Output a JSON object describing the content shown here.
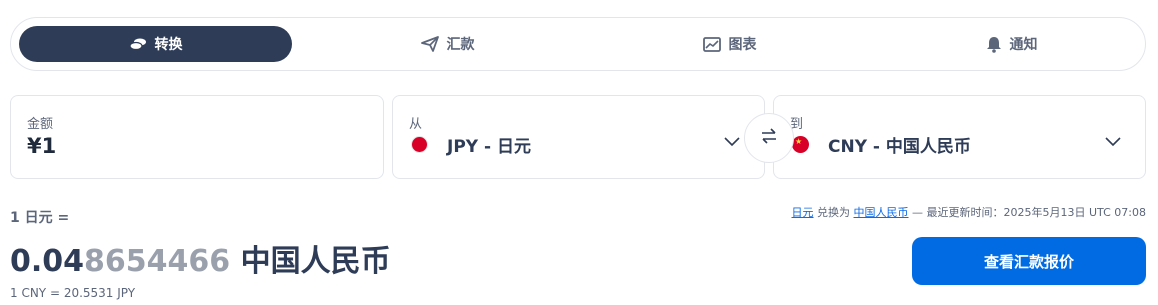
{
  "tabs": [
    {
      "label": "转换",
      "icon": "money-icon",
      "active": true
    },
    {
      "label": "汇款",
      "icon": "send-icon",
      "active": false
    },
    {
      "label": "图表",
      "icon": "chart-icon",
      "active": false
    },
    {
      "label": "通知",
      "icon": "bell-icon",
      "active": false
    }
  ],
  "amount": {
    "label": "金额",
    "value": "¥1"
  },
  "from": {
    "label": "从",
    "currency": "JPY - 日元",
    "flag": "japan-flag-icon"
  },
  "to": {
    "label": "到",
    "currency": "CNY - 中国人民币",
    "flag": "china-flag-icon"
  },
  "result": {
    "rate_label": "1 日元 =",
    "value_main": "0.04",
    "value_faded": "8654466",
    "currency": " 中国人民币",
    "inverse": "1 CNY = 20.5531 JPY"
  },
  "update": {
    "from_link": "日元",
    "middle": " 兑换为 ",
    "to_link": "中国人民币",
    "suffix": " — 最近更新时间：2025年5月13日 UTC 07:08"
  },
  "quote_button": "查看汇款报价",
  "colors": {
    "primary": "#006be3",
    "active_tab": "#2e3c57",
    "text": "#2e3c57",
    "muted": "#5c667b"
  }
}
